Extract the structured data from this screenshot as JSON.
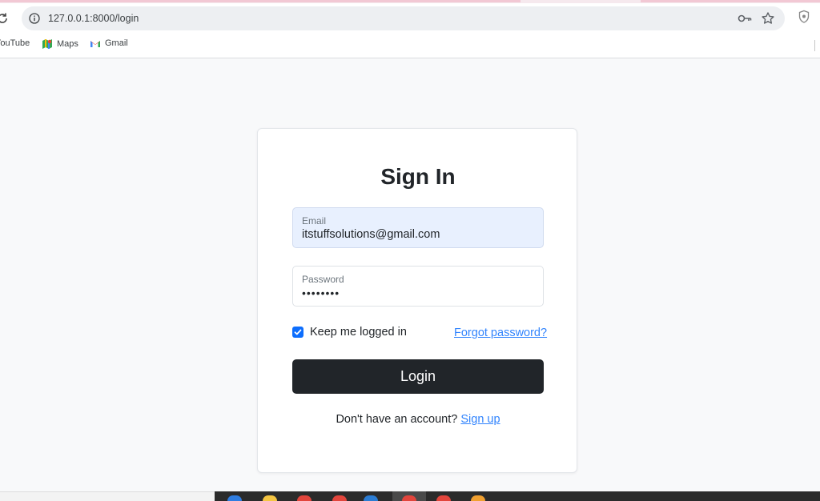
{
  "browser": {
    "url": "127.0.0.1:8000/login",
    "bookmarks": [
      {
        "label": "YouTube",
        "icon": "youtube-icon"
      },
      {
        "label": "Maps",
        "icon": "maps-icon"
      },
      {
        "label": "Gmail",
        "icon": "gmail-icon"
      }
    ]
  },
  "login": {
    "title": "Sign In",
    "email_label": "Email",
    "email_value": "itstuffsolutions@gmail.com",
    "password_label": "Password",
    "password_value": "••••••••",
    "remember_label": "Keep me logged in",
    "remember_checked": true,
    "forgot_link": "Forgot password?",
    "login_button": "Login",
    "signup_prompt": "Don't have an account?",
    "signup_link": "Sign up"
  },
  "colors": {
    "primary": "#0d6efd",
    "button_dark": "#212529",
    "page_background": "#f8f9fa",
    "autofill_background": "#e8f0fe"
  }
}
